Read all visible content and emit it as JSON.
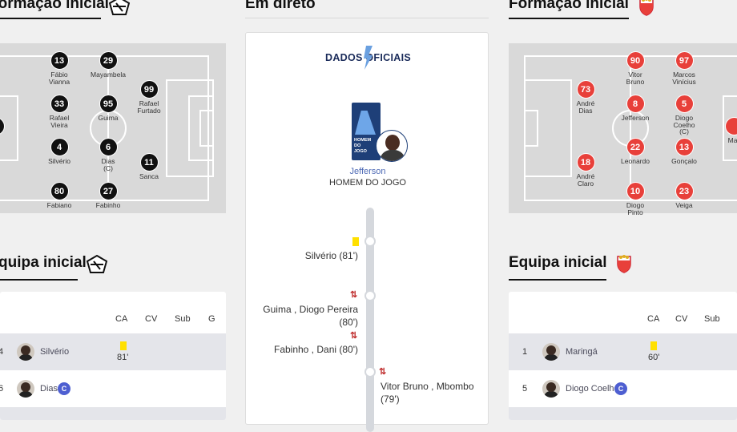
{
  "left_lineup": {
    "title": "Formação inicial",
    "players": [
      {
        "num": "13",
        "name": "Fábio\nVianna"
      },
      {
        "num": "29",
        "name": "Mayambela"
      },
      {
        "num": "99",
        "name": "Rafael\nFurtado"
      },
      {
        "num": "33",
        "name": "Rafael\nVieira"
      },
      {
        "num": "95",
        "name": "Guima"
      },
      {
        "num": "4",
        "name": "Silvério"
      },
      {
        "num": "6",
        "name": "Dias\n(C)"
      },
      {
        "num": "11",
        "name": "Sanca"
      },
      {
        "num": "80",
        "name": "Fabiano"
      },
      {
        "num": "27",
        "name": "Fabinho"
      },
      {
        "num": "",
        "name": "a"
      }
    ]
  },
  "live": {
    "title": "Em direto",
    "brand": "DADOS OFICIAIS",
    "badge_text": "HOMEM DO JOGO",
    "mvp_name": "Jefferson",
    "mvp_label": "HOMEM DO JOGO",
    "events": [
      {
        "side": "left",
        "type": "yellow",
        "text": "Silvério (81')"
      },
      {
        "side": "left",
        "type": "sub",
        "line1": "Guima , Diogo Pereira",
        "line2": "(80')"
      },
      {
        "side": "left",
        "type": "sub",
        "line1": "Fabinho , Dani (80')"
      },
      {
        "side": "right",
        "type": "sub",
        "line1": "Vitor Bruno , Mbombo",
        "line2": "(79')"
      }
    ]
  },
  "right_lineup": {
    "title": "Formação inicial",
    "players": [
      {
        "num": "90",
        "name": "Vitor\nBruno"
      },
      {
        "num": "97",
        "name": "Marcos\nVinícius"
      },
      {
        "num": "73",
        "name": "André\nDias"
      },
      {
        "num": "8",
        "name": "Jefferson"
      },
      {
        "num": "5",
        "name": "Diogo\nCoelho\n(C)"
      },
      {
        "num": "22",
        "name": "Leonardo"
      },
      {
        "num": "13",
        "name": "Gonçalo"
      },
      {
        "num": "18",
        "name": "André\nClaro"
      },
      {
        "num": "10",
        "name": "Diogo\nPinto"
      },
      {
        "num": "23",
        "name": "Veiga"
      },
      {
        "num": "",
        "name": "Mar"
      }
    ]
  },
  "left_table": {
    "title": "quipa inicial",
    "headers": [
      "CA",
      "CV",
      "Sub",
      "G"
    ],
    "rows": [
      {
        "num": "4",
        "name": "Silvério",
        "ca": "81'",
        "captain": ""
      },
      {
        "num": "6",
        "name": "Dias",
        "ca": "",
        "captain": "C"
      }
    ]
  },
  "right_table": {
    "title": "Equipa inicial",
    "headers": [
      "CA",
      "CV",
      "Sub"
    ],
    "rows": [
      {
        "num": "1",
        "name": "Maringá",
        "ca": "60'",
        "captain": ""
      },
      {
        "num": "5",
        "name": "Diogo Coelho",
        "ca": "",
        "captain": "C"
      }
    ]
  },
  "colors": {
    "home": "#111111",
    "away": "#e8403a",
    "captain": "#4e5fd1",
    "yellow_card": "#ffe000",
    "row_shade": "#e4e5ea"
  }
}
